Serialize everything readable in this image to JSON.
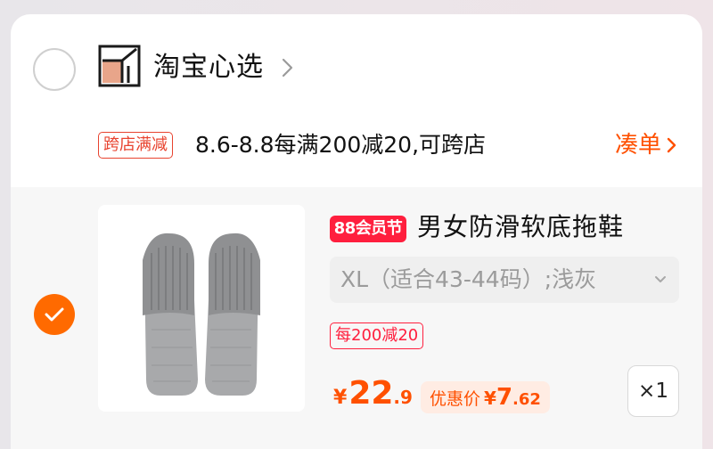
{
  "shop": {
    "name": "淘宝心选",
    "selected": false,
    "logo_colors": {
      "fill": "#e8a58a",
      "stroke": "#1a1a1a"
    }
  },
  "promo": {
    "tag": "跨店满减",
    "text": "8.6-8.8每满200减20,可跨店",
    "action": "凑单"
  },
  "item": {
    "selected": true,
    "badge": "88会员节",
    "title": "男女防滑软底拖鞋",
    "sku": "XL（适合43-44码）;浅灰",
    "discount_tag": "每200减20",
    "price": {
      "currency": "¥",
      "integer": "22",
      "decimal": ".9"
    },
    "deal": {
      "label": "优惠价",
      "currency": "¥",
      "integer": "7",
      "decimal": ".62"
    },
    "quantity": "×1",
    "image_icon": "slippers-icon"
  },
  "colors": {
    "accent": "#ff5000",
    "checkbox": "#ff6a00",
    "badge_red": "#ff1f3e",
    "promo_red": "#e8432f"
  }
}
